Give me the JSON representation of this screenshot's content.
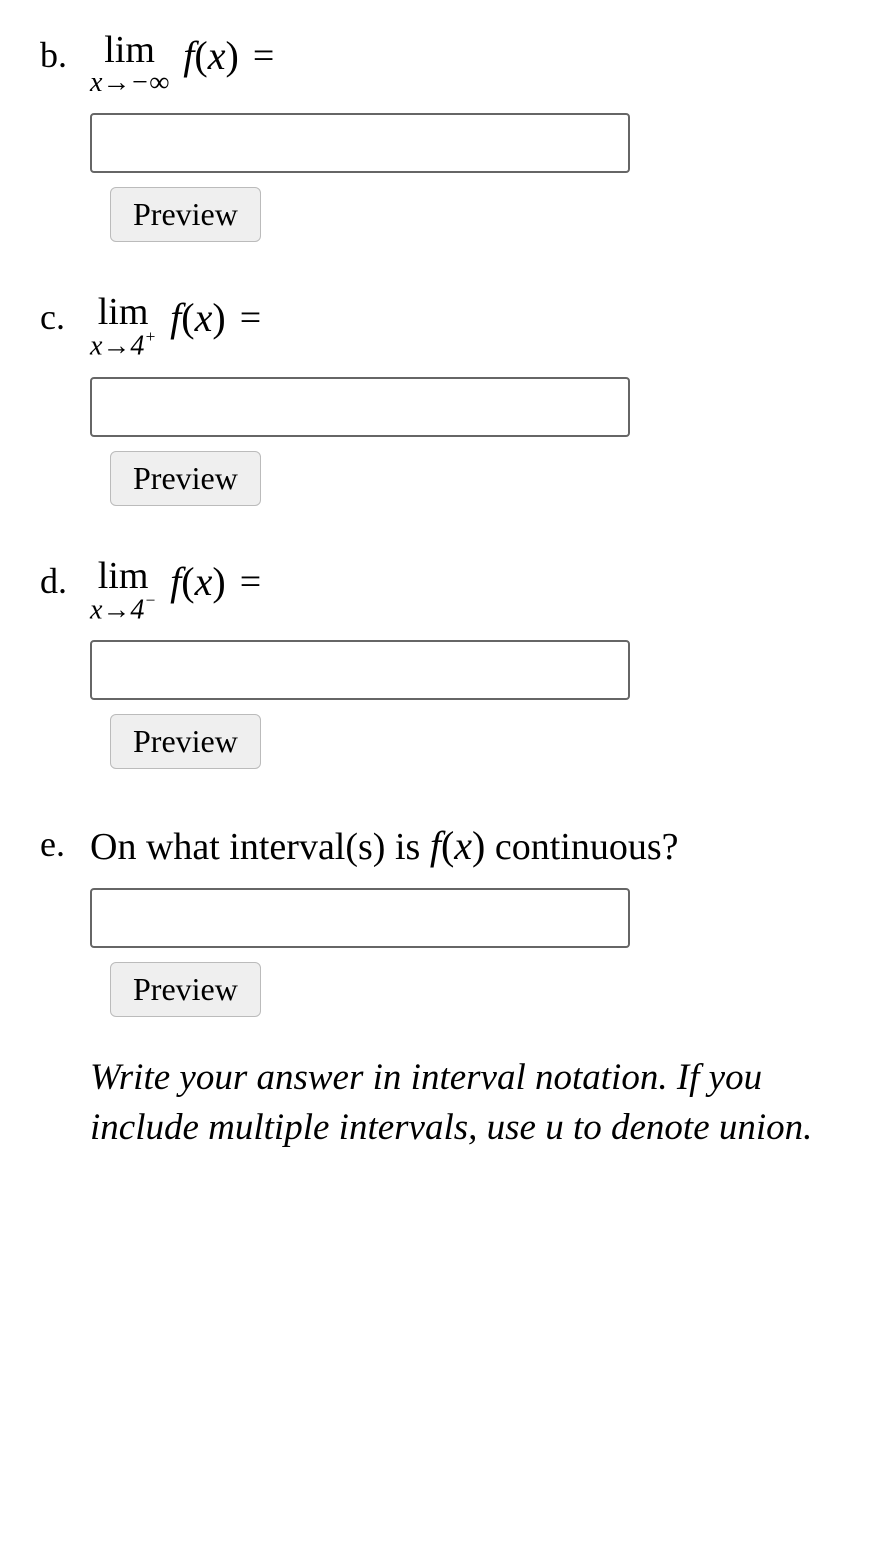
{
  "questions": {
    "b": {
      "label": "b.",
      "lim_top": "lim",
      "lim_sub_pre": "x→−∞",
      "func_letter": "f",
      "func_arg": "x",
      "equals": "=",
      "preview": "Preview"
    },
    "c": {
      "label": "c.",
      "lim_top": "lim",
      "lim_sub_pre": "x→4",
      "lim_sub_sup": "+",
      "func_letter": "f",
      "func_arg": "x",
      "equals": "=",
      "preview": "Preview"
    },
    "d": {
      "label": "d.",
      "lim_top": "lim",
      "lim_sub_pre": "x→4",
      "lim_sub_sup": "−",
      "func_letter": "f",
      "func_arg": "x",
      "equals": "=",
      "preview": "Preview"
    },
    "e": {
      "label": "e.",
      "text_pre": "On what interval(s) is ",
      "func_letter": "f",
      "func_arg": "x",
      "text_post": " continuous?",
      "preview": "Preview",
      "hint_pre": "Write your answer in interval notation. If you include multiple intervals, use ",
      "hint_var": "u",
      "hint_post": " to denote union."
    }
  }
}
